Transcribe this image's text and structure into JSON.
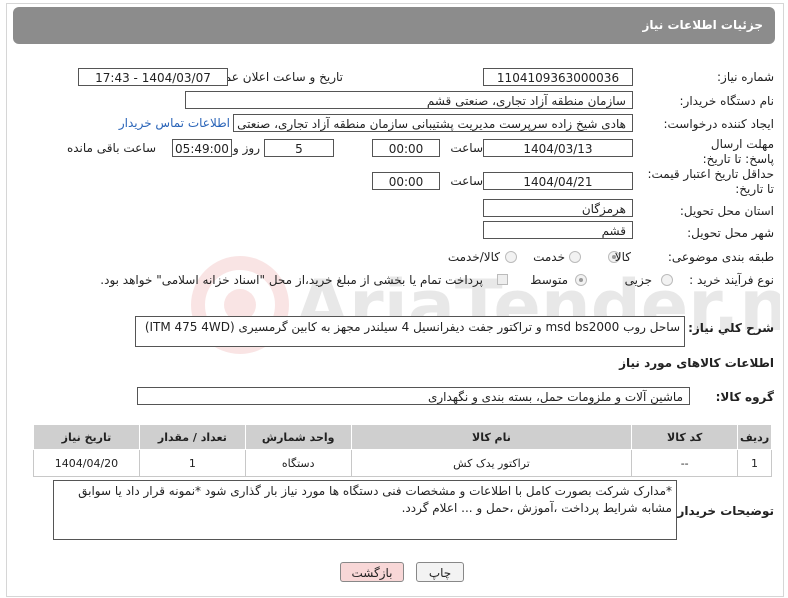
{
  "header": {
    "title": "جزئیات اطلاعات نیاز"
  },
  "fields": {
    "need_number_label": "شماره نیاز:",
    "need_number": "1104109363000036",
    "announce_label": "تاریخ و ساعت اعلان عمومی:",
    "announce_value": "1404/03/07 - 17:43",
    "buyer_org_label": "نام دستگاه خریدار:",
    "buyer_org": "سازمان منطقه آزاد تجاری، صنعتی قشم",
    "creator_label": "ایجاد کننده درخواست:",
    "creator": "هادی شیخ زاده سرپرست مدیریت پشتیبانی سازمان منطقه آزاد تجاری، صنعتی",
    "contact_link": "اطلاعات تماس خریدار",
    "deadline_label": "مهلت ارسال پاسخ: تا تاریخ:",
    "deadline_date": "1404/03/13",
    "time_label": "ساعت",
    "deadline_time": "00:00",
    "days_value": "5",
    "days_label": "روز و",
    "remaining_time": "05:49:00",
    "remaining_label": "ساعت باقی مانده",
    "validity_label": "حداقل تاریخ اعتبار قیمت: تا تاریخ:",
    "validity_date": "1404/04/21",
    "validity_time": "00:00",
    "province_label": "استان محل تحویل:",
    "province": "هرمزگان",
    "city_label": "شهر محل تحویل:",
    "city": "قشم",
    "category_label": "طبقه بندی موضوعی:",
    "category_options": [
      "کالا",
      "خدمت",
      "کالا/خدمت"
    ],
    "process_label": "نوع فرآیند خرید :",
    "process_options": [
      "جزیی",
      "متوسط"
    ],
    "payment_note": "پرداخت تمام یا بخشی از مبلغ خرید،از محل \"اسناد خزانه اسلامی\" خواهد بود."
  },
  "description": {
    "label": "شرح کلي نياز:",
    "text": "ساحل روب msd bs2000 و تراکتور جفت دیفرانسیل 4 سیلندر مجهز به کابین گرمسیری (ITM 475 4WD)"
  },
  "goods": {
    "section_title": "اطلاعات کالاهای مورد نیاز",
    "group_label": "گروه کالا:",
    "group_value": "ماشین آلات و ملزومات حمل، بسته بندی و نگهداری",
    "columns": [
      "ردیف",
      "کد کالا",
      "نام کالا",
      "واحد شمارش",
      "تعداد / مقدار",
      "تاریخ نیاز"
    ],
    "rows": [
      {
        "row": "1",
        "code": "--",
        "name": "تراکتور یدک کش",
        "unit": "دستگاه",
        "qty": "1",
        "date": "1404/04/20"
      }
    ]
  },
  "buyer_notes": {
    "label": "توضیحات خریدار:",
    "text": "*مدارک شرکت بصورت کامل با اطلاعات و مشخصات فنی دستگاه ها مورد نیاز بار گذاری شود *نمونه قرار داد یا سوابق مشابه شرایط پرداخت ،آموزش ،حمل و ... اعلام گردد."
  },
  "buttons": {
    "print": "چاپ",
    "back": "بازگشت"
  },
  "watermark": "AriaTender.neT",
  "colors": {
    "header": "#8c8c8c",
    "link": "#2a64b8",
    "back_button": "#f8d7d7",
    "watermark": "#d23a3a"
  }
}
